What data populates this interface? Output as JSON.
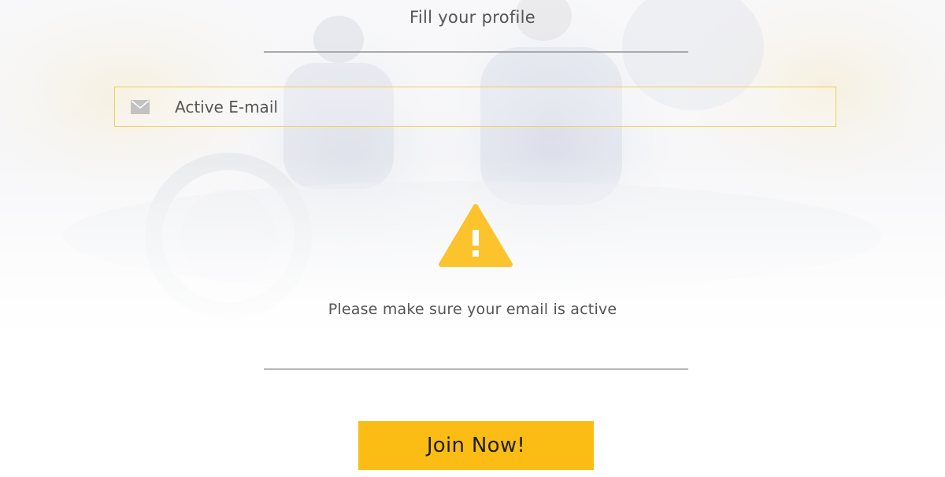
{
  "profile": {
    "title": "Fill your profile"
  },
  "email": {
    "placeholder": "Active E-mail",
    "icon": "mail-icon"
  },
  "notice": {
    "icon": "warning-icon",
    "text": "Please make sure your email is active"
  },
  "actions": {
    "join_label": "Join Now!"
  },
  "colors": {
    "accent": "#fbbd13",
    "field_border": "#f0cf56",
    "text": "#555555",
    "warning": "#fcc32c"
  }
}
